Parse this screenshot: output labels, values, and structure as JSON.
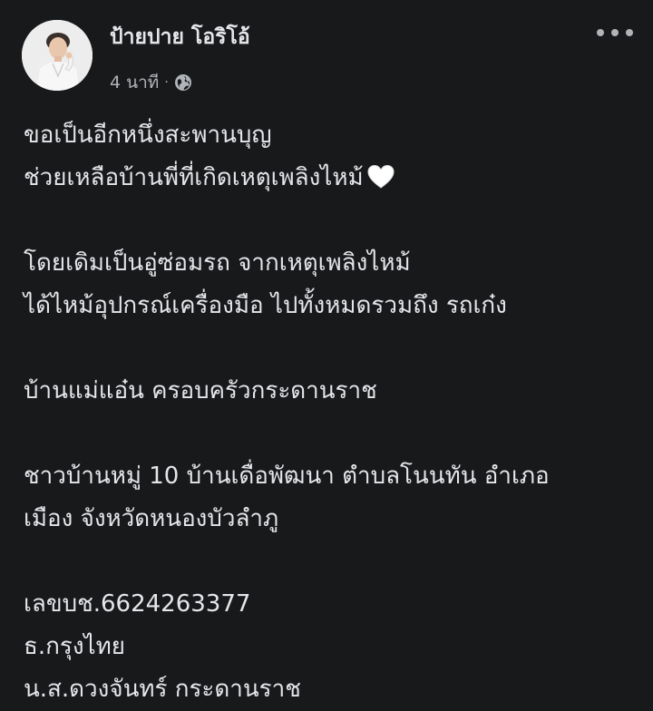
{
  "post": {
    "author": "ป้ายปาย โอริโอ้",
    "time": "4 นาที",
    "separator": "·",
    "privacy_icon": "globe-icon",
    "more_icon": "more-options-icon",
    "lines": [
      "ขอเป็นอีกหนึ่งสะพานบุญ",
      "ช่วยเหลือบ้านพี่ที่เกิดเหตุเพลิงไหม้",
      "",
      "โดยเดิมเป็นอู่ซ่อมรถ จากเหตุเพลิงไหม้",
      "ได้ไหม้อุปกรณ์เครื่องมือ ไปทั้งหมดรวมถึง รถเก๋ง",
      "",
      "บ้านแม่แอ๋น ครอบครัวกระดานราช",
      "",
      "ชาวบ้านหมู่ 10 บ้านเดื่อพัฒนา ตำบลโนนทัน อำเภอ",
      "เมือง  จังหวัดหนองบัวลำภู",
      "",
      "เลขบช.6624263377",
      "ธ.กรุงไทย",
      "น.ส.ดวงจันทร์ กระดานราช"
    ],
    "emoji": "white-heart-icon"
  },
  "colors": {
    "background": "#18191a",
    "text_primary": "#e4e6eb",
    "text_secondary": "#b0b3b8"
  }
}
